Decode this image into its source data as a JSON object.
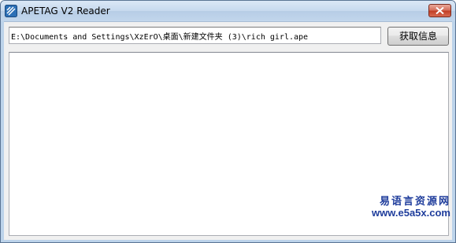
{
  "window": {
    "title": "APETAG V2 Reader",
    "app_icon": "app-icon",
    "close_icon": "close-icon"
  },
  "form": {
    "path_value": "E:\\Documents and Settings\\XzErO\\桌面\\新建文件夹 (3)\\rich girl.ape",
    "get_info_label": "获取信息"
  },
  "info_area": {
    "content": ""
  },
  "watermark": {
    "name": "易语言资源网",
    "url": "www.e5a5x.com"
  },
  "colors": {
    "watermark": "#1f3d9c",
    "close_button": "#c23f26"
  }
}
